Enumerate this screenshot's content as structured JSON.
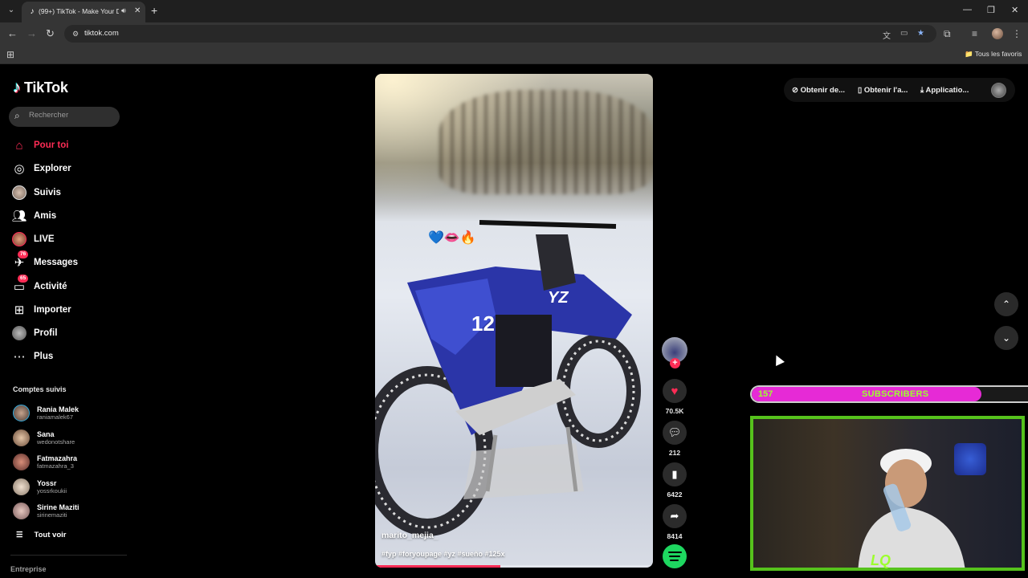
{
  "browser": {
    "tab_title": "(99+) TikTok - Make Your Day",
    "url": "tiktok.com",
    "bookmarks_all": "Tous les favoris"
  },
  "tiktok": {
    "logo_text": "TikTok",
    "search_placeholder": "Rechercher",
    "nav": [
      {
        "label": "Pour toi",
        "icon": "home-icon",
        "active": true
      },
      {
        "label": "Explorer",
        "icon": "compass-icon"
      },
      {
        "label": "Suivis",
        "icon": "following-avatar-icon"
      },
      {
        "label": "Amis",
        "icon": "friends-icon"
      },
      {
        "label": "LIVE",
        "icon": "live-avatar-icon"
      },
      {
        "label": "Messages",
        "icon": "messages-icon",
        "badge": "76"
      },
      {
        "label": "Activité",
        "icon": "activity-icon",
        "badge": "65"
      },
      {
        "label": "Importer",
        "icon": "upload-icon"
      },
      {
        "label": "Profil",
        "icon": "profile-avatar-icon"
      },
      {
        "label": "Plus",
        "icon": "more-icon"
      }
    ],
    "following_title": "Comptes suivis",
    "following": [
      {
        "name": "Rania Malek",
        "user": "raniamalek67"
      },
      {
        "name": "Sana",
        "user": "wedonotshare"
      },
      {
        "name": "Fatmazahra",
        "user": "fatmazahra_3"
      },
      {
        "name": "Yossr",
        "user": "yossrkoukii"
      },
      {
        "name": "Sirine Maziti",
        "user": "sirinemaziti"
      }
    ],
    "see_all": "Tout voir",
    "footer_link": "Entreprise",
    "top_actions": {
      "coins": "Obtenir de...",
      "app": "Obtenir l'a...",
      "desktop": "Applicatio..."
    },
    "video": {
      "author": "marito_mejia_",
      "hashtags": "#fyp #foryoupage #yz #sueño #125x",
      "overlay_emoji": "💙👄🔥",
      "progress": 0.45
    },
    "actions": {
      "likes": "70.5K",
      "comments": "212",
      "saves": "6422",
      "shares": "8414"
    }
  },
  "stream_overlay": {
    "subs_count": "157",
    "subs_label": "SUBSCRIBERS",
    "subs_fill": 0.83
  },
  "colors": {
    "brand": "#fe2c55",
    "overlay_green": "#9dff2e",
    "overlay_pink": "#e62ad6"
  }
}
